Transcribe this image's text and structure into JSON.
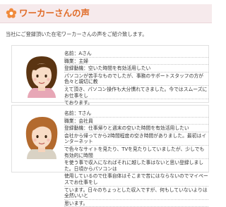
{
  "section": {
    "title": "ワーカーさんの声",
    "intro": "当社にご登録頂いた在宅ワーカーさんの声をご紹介致します。"
  },
  "labels": {
    "name": "名前：",
    "job": "職業：",
    "reason": "登録動機："
  },
  "workers": [
    {
      "name": "Aさん",
      "job": "主婦",
      "reason": "空いた時間を有効活用したい",
      "comment": [
        "パソコンが苦手なものでしたが、事務のサポートスタッフの方が色々と親切に教",
        "えて頂き、パソコン操作も大分慣れてきました。今ではスムーズにお仕事をし",
        "ております。"
      ]
    },
    {
      "name": "Tさん",
      "job": "会社員",
      "reason": "仕事帰りと週末の空いた時間を有効活用したい",
      "comment": [
        "会社から帰ってから2時間程度の空き時間がありました。最初はインターネット",
        "で色々なサイトを見たり、TVを見たりしていましたが、少しでも有効的に時間",
        "を使う事で収入になればそれに越した事はないと思い登録しました。日頃からパソコンは",
        "使用しているので仕事自体はそこまで苦にはならないのでマイペースでお仕事をし",
        "ています。日々のちょっとした収入ですが、何もしていないよりは全然いいと",
        "思います。"
      ]
    }
  ]
}
